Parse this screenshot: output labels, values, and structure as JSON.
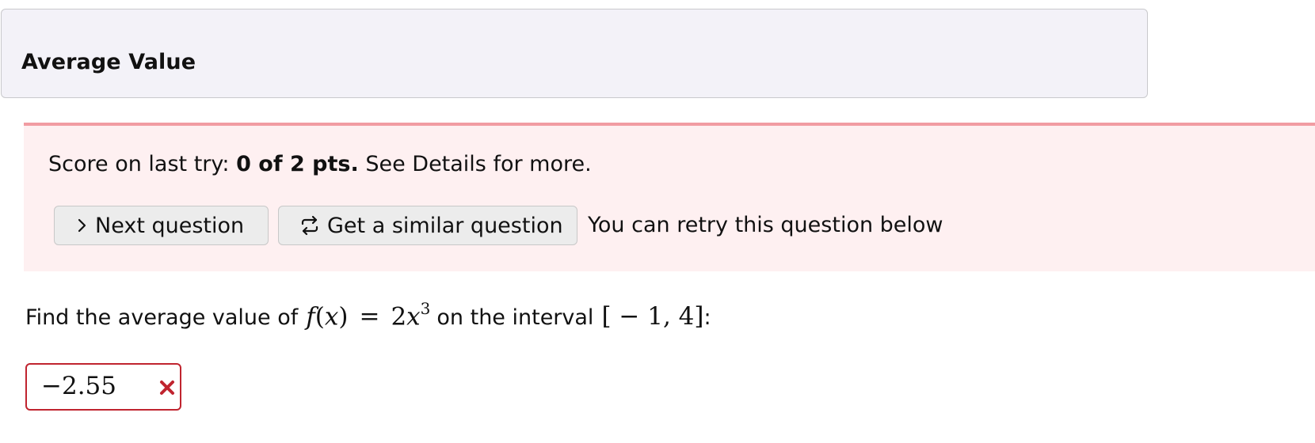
{
  "header": {
    "title": "Average Value"
  },
  "alert": {
    "score_prefix": "Score on last try:",
    "score_value": "0 of 2 pts.",
    "score_suffix": "See Details for more.",
    "next_button_label": "Next question",
    "next_button_icon": "chevron-right-icon",
    "similar_button_label": "Get a similar question",
    "similar_button_icon": "repeat-arrows-icon",
    "retry_text": "You can retry this question below",
    "background_color": "#fef0f1",
    "border_color": "#f19ca2"
  },
  "question": {
    "prefix": "Find the average value of",
    "function_name": "f",
    "variable": "x",
    "equals": "=",
    "coefficient": "2",
    "exponent": "3",
    "middle": "on the interval",
    "interval": "[ − 1, 4]",
    "suffix": ":"
  },
  "answer": {
    "value": "−2.55",
    "status": "incorrect",
    "status_icon": "x-mark-icon",
    "error_color": "#c0242f"
  }
}
